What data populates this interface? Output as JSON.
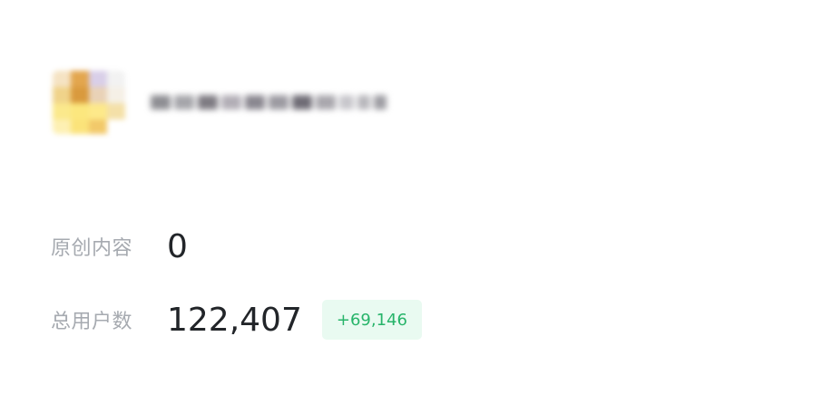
{
  "account": {
    "name_obscured": true,
    "avatar_obscured": true
  },
  "stats": {
    "original_content": {
      "label": "原创内容",
      "value": "0"
    },
    "total_users": {
      "label": "总用户数",
      "value": "122,407",
      "delta": "+69,146"
    }
  },
  "colors": {
    "label": "#a6aab0",
    "value": "#222529",
    "delta_text": "#27b46a",
    "delta_bg": "#e9faf1"
  }
}
